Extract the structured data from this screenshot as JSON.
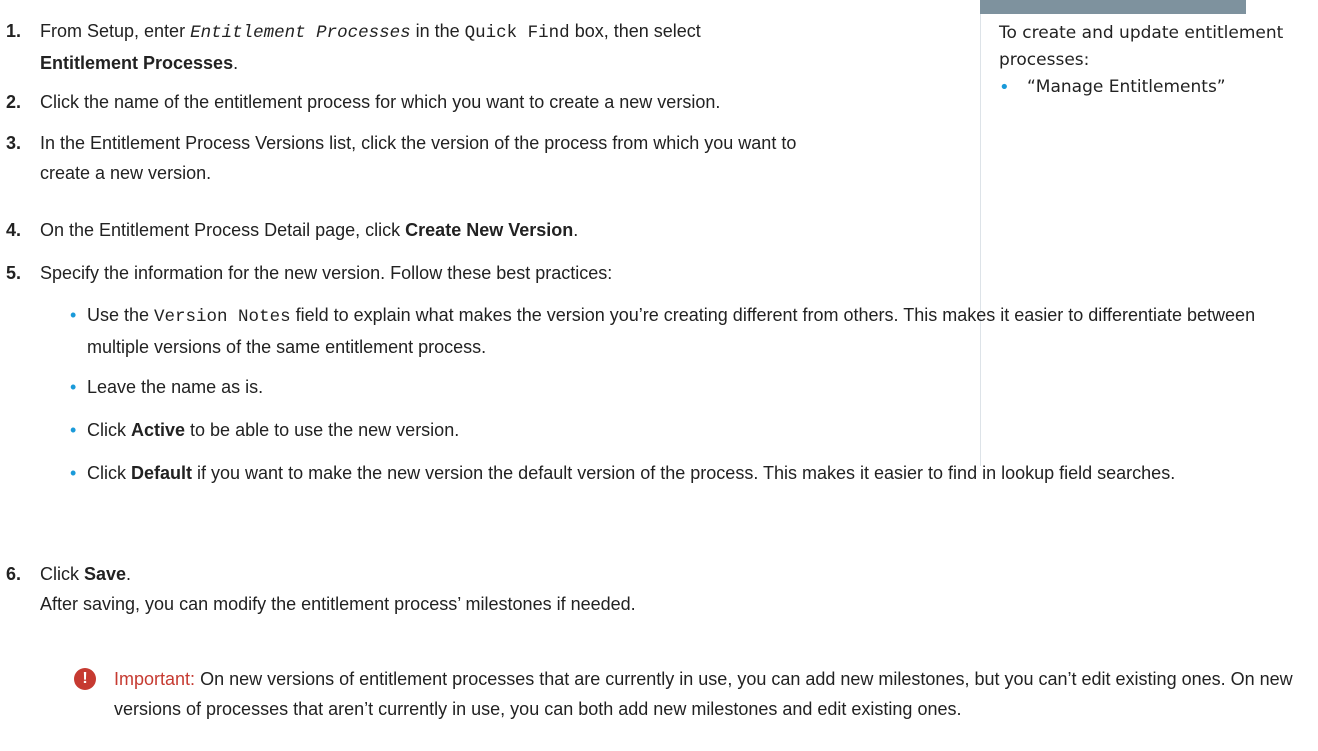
{
  "sidebar": {
    "heading": "To create and update entitlement processes:",
    "permission": "“Manage Entitlements”"
  },
  "steps": {
    "s1": {
      "num": "1.",
      "pre": "From Setup, enter ",
      "code": "Entitlement Processes",
      "mid": " in the ",
      "code2": "Quick Find",
      "post": " box, then select",
      "bold": "Entitlement Processes",
      "end": "."
    },
    "s2": {
      "num": "2.",
      "text": "Click the name of the entitlement process for which you want to create a new version."
    },
    "s3": {
      "num": "3.",
      "text": "In the Entitlement Process Versions list, click the version of the process from which you want to create a new version."
    },
    "s4": {
      "num": "4.",
      "pre": "On the Entitlement Process Detail page, click ",
      "bold": "Create New Version",
      "end": "."
    },
    "s5": {
      "num": "5.",
      "text": "Specify the information for the new version. Follow these best practices:"
    },
    "s6": {
      "num": "6.",
      "pre": "Click ",
      "bold": "Save",
      "end": ".",
      "note": "After saving, you can modify the entitlement process’ milestones if needed."
    }
  },
  "bullets": {
    "b1": {
      "pre": "Use the ",
      "code": "Version Notes",
      "post": " field to explain what makes the version you’re creating different from others. This makes it easier to differentiate between multiple versions of the same entitlement process."
    },
    "b2": {
      "text": "Leave the name as is."
    },
    "b3": {
      "pre": "Click ",
      "bold": "Active",
      "post": " to be able to use the new version."
    },
    "b4": {
      "pre": "Click ",
      "bold": "Default",
      "post": " if you want to make the new version the default version of the process. This makes it easier to find in lookup field searches."
    }
  },
  "important": {
    "icon": "alert-icon",
    "label": "Important:",
    "text": "On new versions of entitlement processes that are currently in use, you can add new milestones, but you can’t edit existing ones. On new versions of processes that aren’t currently in use, you can both add new milestones and edit existing ones."
  },
  "colors": {
    "accent": "#1a9ad9",
    "important": "#c63a31",
    "sidebar_bar": "#7e929e"
  }
}
